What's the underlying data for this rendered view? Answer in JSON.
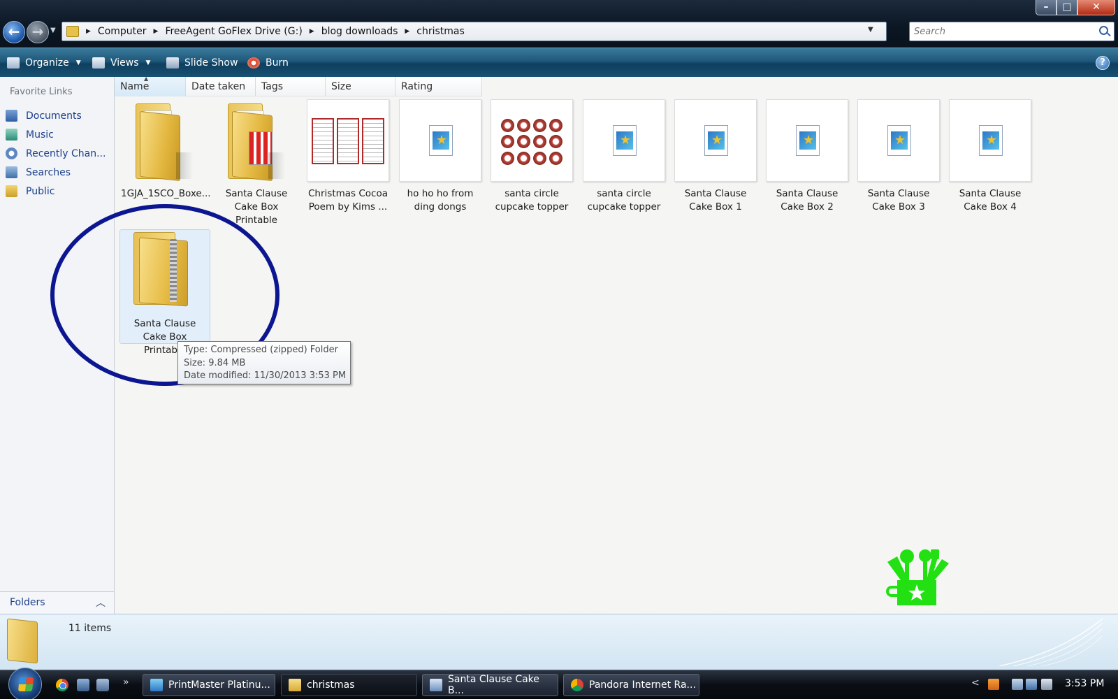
{
  "window": {
    "min_glyph": "–",
    "max_glyph": "□",
    "close_glyph": "✕"
  },
  "address": {
    "crumbs": [
      "Computer",
      "FreeAgent GoFlex Drive (G:)",
      "blog downloads",
      "christmas"
    ]
  },
  "search": {
    "placeholder": "Search"
  },
  "toolbar": {
    "organize": "Organize",
    "views": "Views",
    "slideshow": "Slide Show",
    "burn": "Burn",
    "help": "?"
  },
  "nav": {
    "heading": "Favorite Links",
    "items": [
      "Documents",
      "Music",
      "Recently Chan...",
      "Searches",
      "Public"
    ],
    "folders_label": "Folders"
  },
  "columns": [
    "Name",
    "Date taken",
    "Tags",
    "Size",
    "Rating"
  ],
  "files": [
    {
      "label": "1GJA_1SCO_Boxe...",
      "icon": "folder-icon"
    },
    {
      "label": "Santa Clause Cake Box Printable",
      "icon": "folder-icon"
    },
    {
      "label": "Christmas Cocoa Poem by Kims ...",
      "icon": "image-thumbnail"
    },
    {
      "label": "ho ho ho from ding dongs",
      "icon": "document-icon"
    },
    {
      "label": "santa circle cupcake topper",
      "icon": "image-thumbnail"
    },
    {
      "label": "santa circle cupcake topper",
      "icon": "document-icon"
    },
    {
      "label": "Santa Clause Cake Box 1",
      "icon": "document-icon"
    },
    {
      "label": "Santa Clause Cake Box 2",
      "icon": "document-icon"
    },
    {
      "label": "Santa Clause Cake Box 3",
      "icon": "document-icon"
    },
    {
      "label": "Santa Clause Cake Box 4",
      "icon": "document-icon"
    },
    {
      "label": "Santa Clause Cake Box Printable",
      "icon": "zip-folder-icon"
    }
  ],
  "tooltip": {
    "type": "Type: Compressed (zipped) Folder",
    "size": "Size: 9.84 MB",
    "date": "Date modified: 11/30/2013 3:53 PM"
  },
  "details": {
    "count": "11 items"
  },
  "taskbar": {
    "more": "»",
    "tasks": [
      "PrintMaster Platinu...",
      "christmas",
      "Santa Clause Cake B...",
      "Pandora Internet Ra..."
    ],
    "tray_arrow": "<",
    "clock": "3:53 PM"
  },
  "colors": {
    "annotation": "#0b1690",
    "logo": "#22e012",
    "link": "#1c3f8c"
  }
}
